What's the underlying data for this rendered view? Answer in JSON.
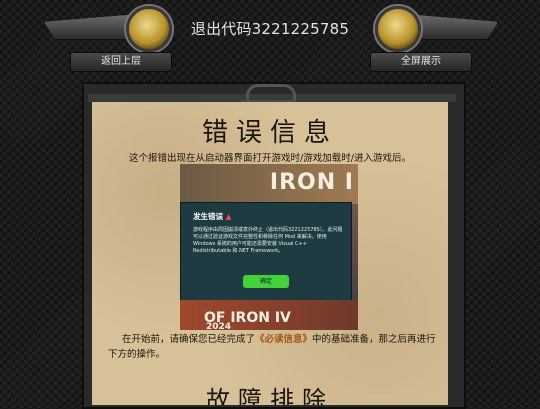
{
  "header": {
    "title": "退出代码3221225785",
    "back_label": "返回上层",
    "fullscreen_label": "全屏展示"
  },
  "doc": {
    "heading": "错误信息",
    "intro": "这个报错出现在从启动器界面打开游戏时/游戏加载时/进入游戏后。",
    "screenshot": {
      "game_title_top": "IRON I",
      "game_title_bottom": "OF IRON IV",
      "year": "2024",
      "dialog_title": "发生错误",
      "dialog_body": "游戏程序由周因崩溃或意外终止（退出代码3221225785）。此问题可以通过验证游戏文件完整性和移除任何 Mod 来解决。使用 Windows 系统的用户可能还需要安装 Visual C++ Redistributable 和.NET Framework。",
      "dialog_ok": "确定"
    },
    "para_before": "在开始前，请确保您已经完成了",
    "para_link": "《必读信息》",
    "para_after": "中的基础准备，那之后再进行下方的操作。",
    "heading2": "故障排除"
  },
  "colors": {
    "paper": "#d7c199",
    "highlight": "#a4571a",
    "ok_button": "#44d23a",
    "warn": "#ff4a4a"
  }
}
